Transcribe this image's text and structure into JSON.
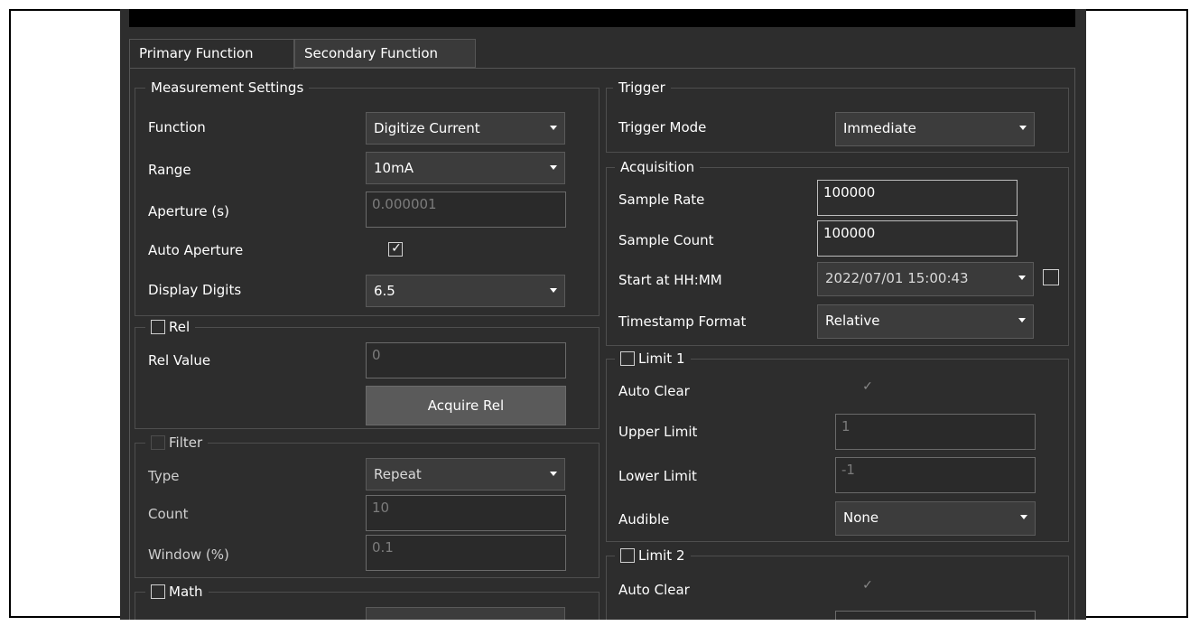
{
  "tabs": {
    "primary": "Primary Function",
    "secondary": "Secondary Function"
  },
  "measurement": {
    "legend": "Measurement Settings",
    "function_label": "Function",
    "function_value": "Digitize Current",
    "range_label": "Range",
    "range_value": "10mA",
    "aperture_label": "Aperture (s)",
    "aperture_value": "0.000001",
    "auto_aperture_label": "Auto Aperture",
    "display_digits_label": "Display Digits",
    "display_digits_value": "6.5"
  },
  "rel": {
    "legend": "Rel",
    "value_label": "Rel Value",
    "value": "0",
    "acquire_button": "Acquire Rel"
  },
  "filter": {
    "legend": "Filter",
    "type_label": "Type",
    "type_value": "Repeat",
    "count_label": "Count",
    "count_value": "10",
    "window_label": "Window (%)",
    "window_value": "0.1"
  },
  "math": {
    "legend": "Math"
  },
  "trigger": {
    "legend": "Trigger",
    "mode_label": "Trigger Mode",
    "mode_value": "Immediate"
  },
  "acquisition": {
    "legend": "Acquisition",
    "sample_rate_label": "Sample Rate",
    "sample_rate_value": "100000",
    "sample_count_label": "Sample Count",
    "sample_count_value": "100000",
    "start_label": "Start at HH:MM",
    "start_value": "2022/07/01 15:00:43",
    "timestamp_label": "Timestamp Format",
    "timestamp_value": "Relative"
  },
  "limit1": {
    "legend": "Limit 1",
    "auto_clear_label": "Auto Clear",
    "upper_label": "Upper Limit",
    "upper_value": "1",
    "lower_label": "Lower Limit",
    "lower_value": "-1",
    "audible_label": "Audible",
    "audible_value": "None"
  },
  "limit2": {
    "legend": "Limit 2",
    "auto_clear_label": "Auto Clear"
  }
}
